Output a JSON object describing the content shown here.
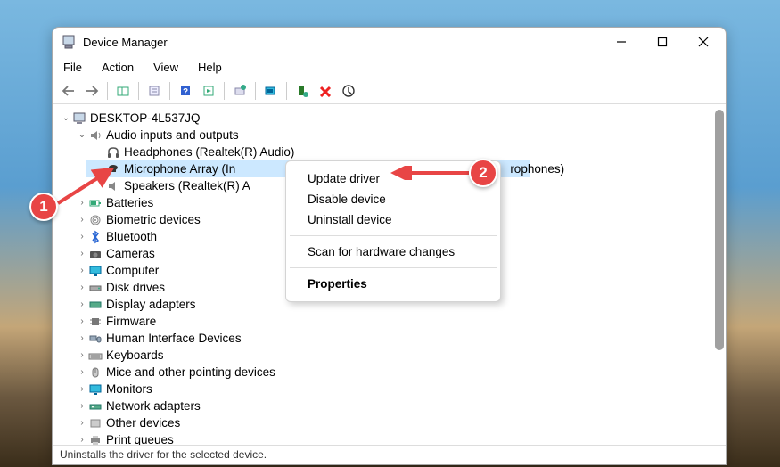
{
  "title": "Device Manager",
  "menus": {
    "file": "File",
    "action": "Action",
    "view": "View",
    "help": "Help"
  },
  "root": "DESKTOP-4L537JQ",
  "audio": {
    "label": "Audio inputs and outputs",
    "headphones": "Headphones (Realtek(R) Audio)",
    "micVisible": "Microphone Array (In",
    "micTail": "rophones)",
    "speakers": "Speakers (Realtek(R) A"
  },
  "categories": {
    "batteries": "Batteries",
    "biometric": "Biometric devices",
    "bluetooth": "Bluetooth",
    "cameras": "Cameras",
    "computer": "Computer",
    "disk": "Disk drives",
    "display": "Display adapters",
    "firmware": "Firmware",
    "hid": "Human Interface Devices",
    "keyboards": "Keyboards",
    "mice": "Mice and other pointing devices",
    "monitors": "Monitors",
    "network": "Network adapters",
    "other": "Other devices",
    "print": "Print queues"
  },
  "context": {
    "update": "Update driver",
    "disable": "Disable device",
    "uninstall": "Uninstall device",
    "scan": "Scan for hardware changes",
    "properties": "Properties"
  },
  "status": "Uninstalls the driver for the selected device.",
  "callouts": {
    "c1": "1",
    "c2": "2"
  }
}
